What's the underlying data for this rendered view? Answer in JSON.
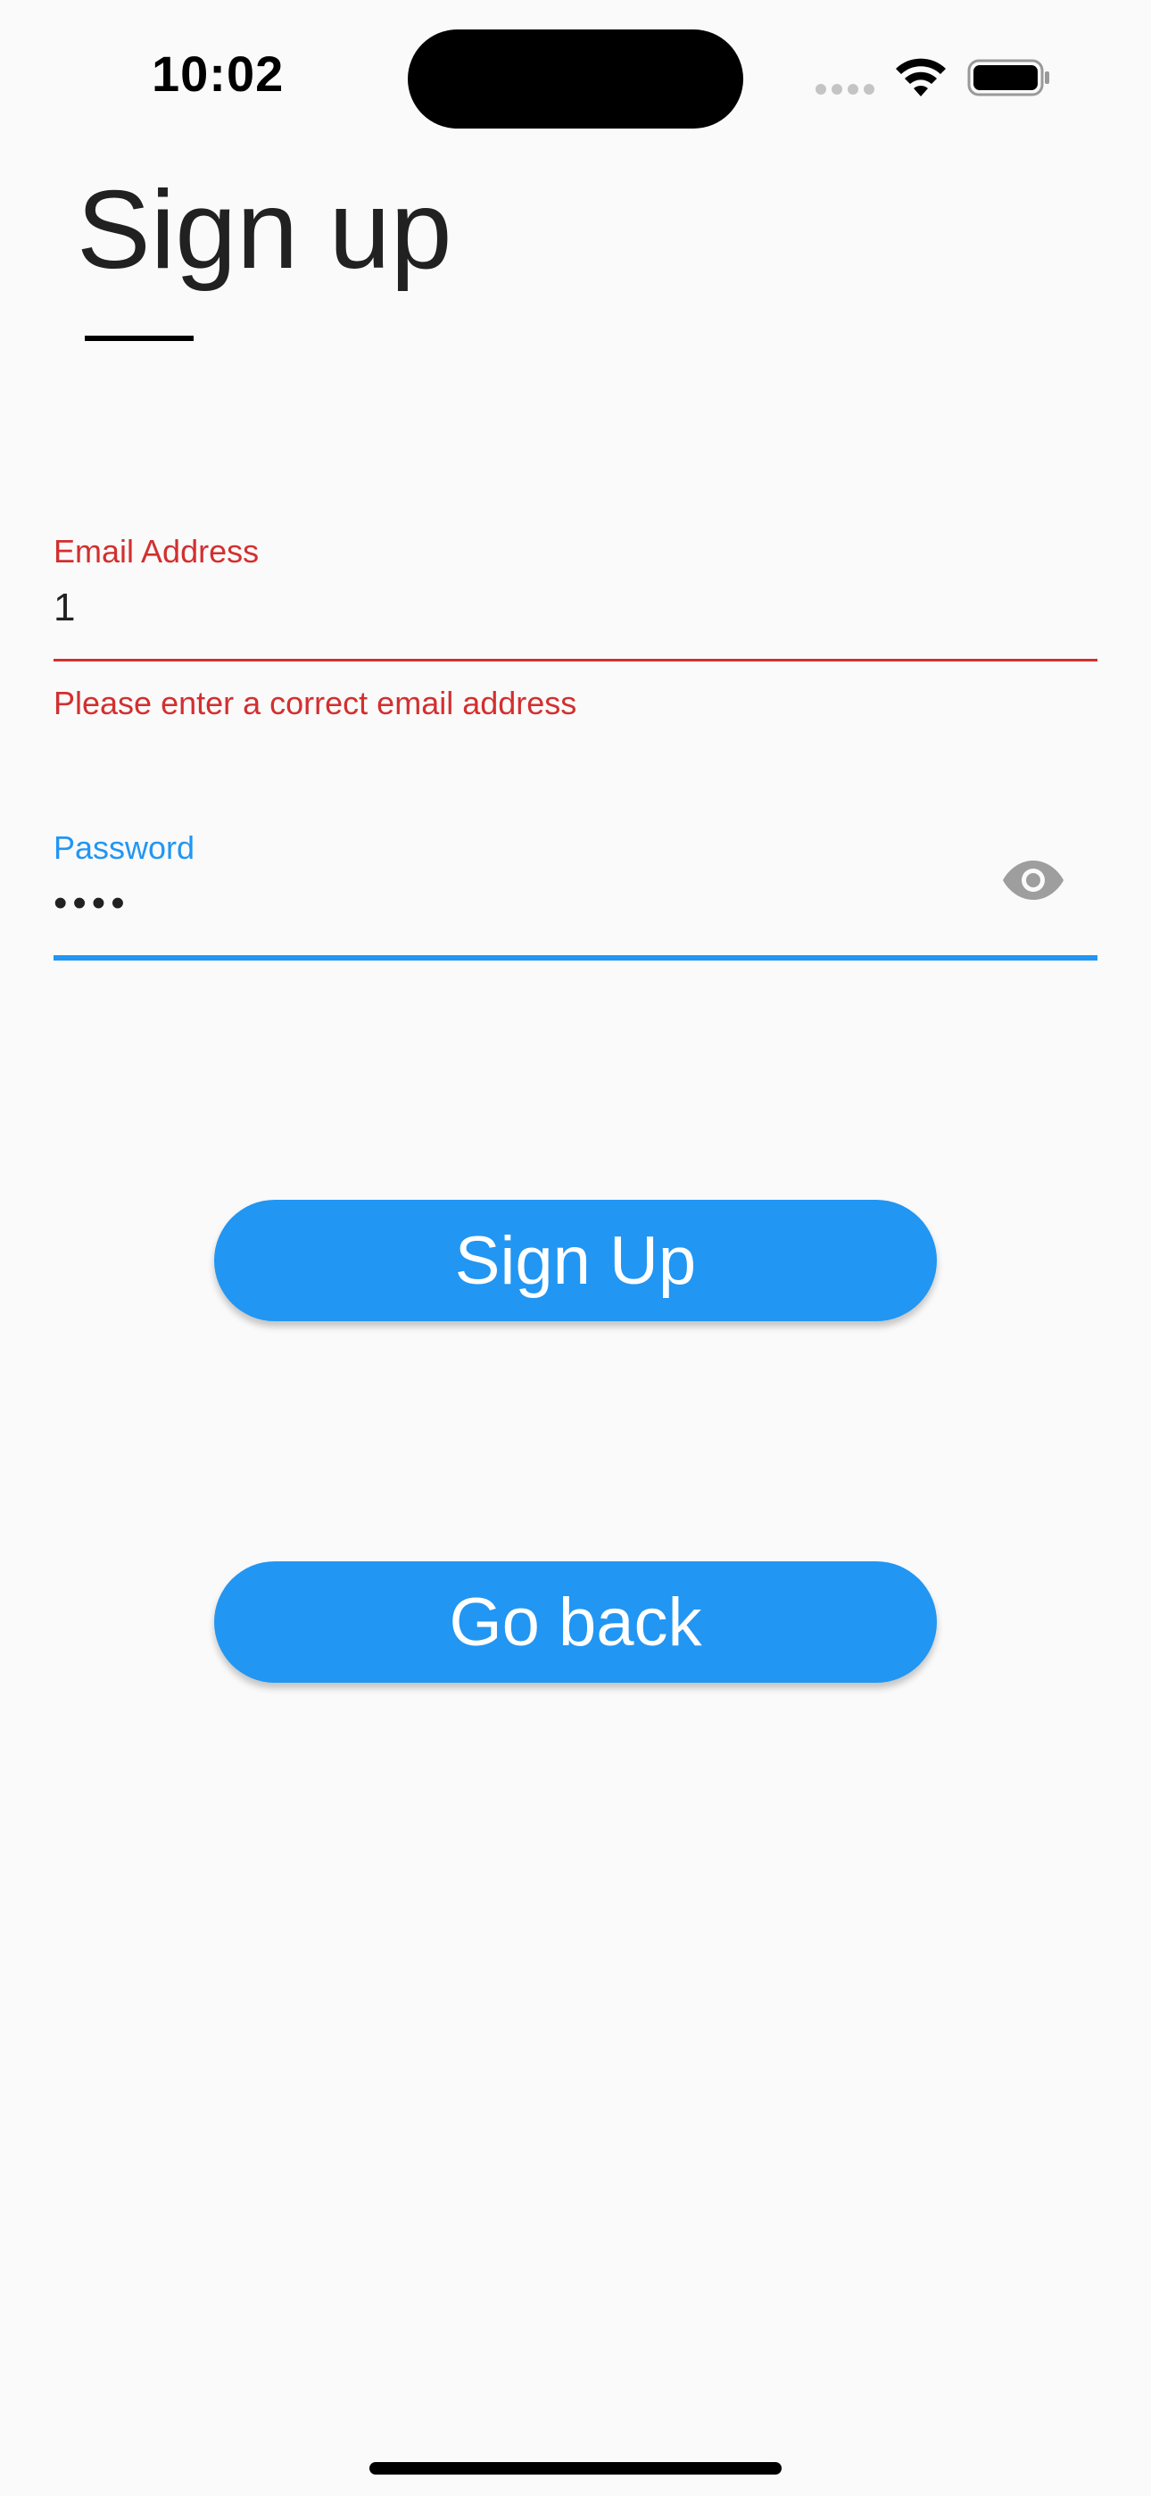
{
  "status_bar": {
    "time": "10:02",
    "icons": [
      "cellular-signal-icon",
      "wifi-icon",
      "battery-icon"
    ]
  },
  "page": {
    "title": "Sign up"
  },
  "form": {
    "email": {
      "label": "Email Address",
      "value": "1",
      "error": "Please enter a correct email address",
      "state": "error"
    },
    "password": {
      "label": "Password",
      "value": "••••",
      "state": "focused",
      "toggle_icon": "eye-icon"
    }
  },
  "buttons": {
    "sign_up": "Sign Up",
    "go_back": "Go back"
  },
  "colors": {
    "accent": "#2196f3",
    "error": "#d32f2f",
    "background": "#fafafa",
    "text": "#212121"
  }
}
